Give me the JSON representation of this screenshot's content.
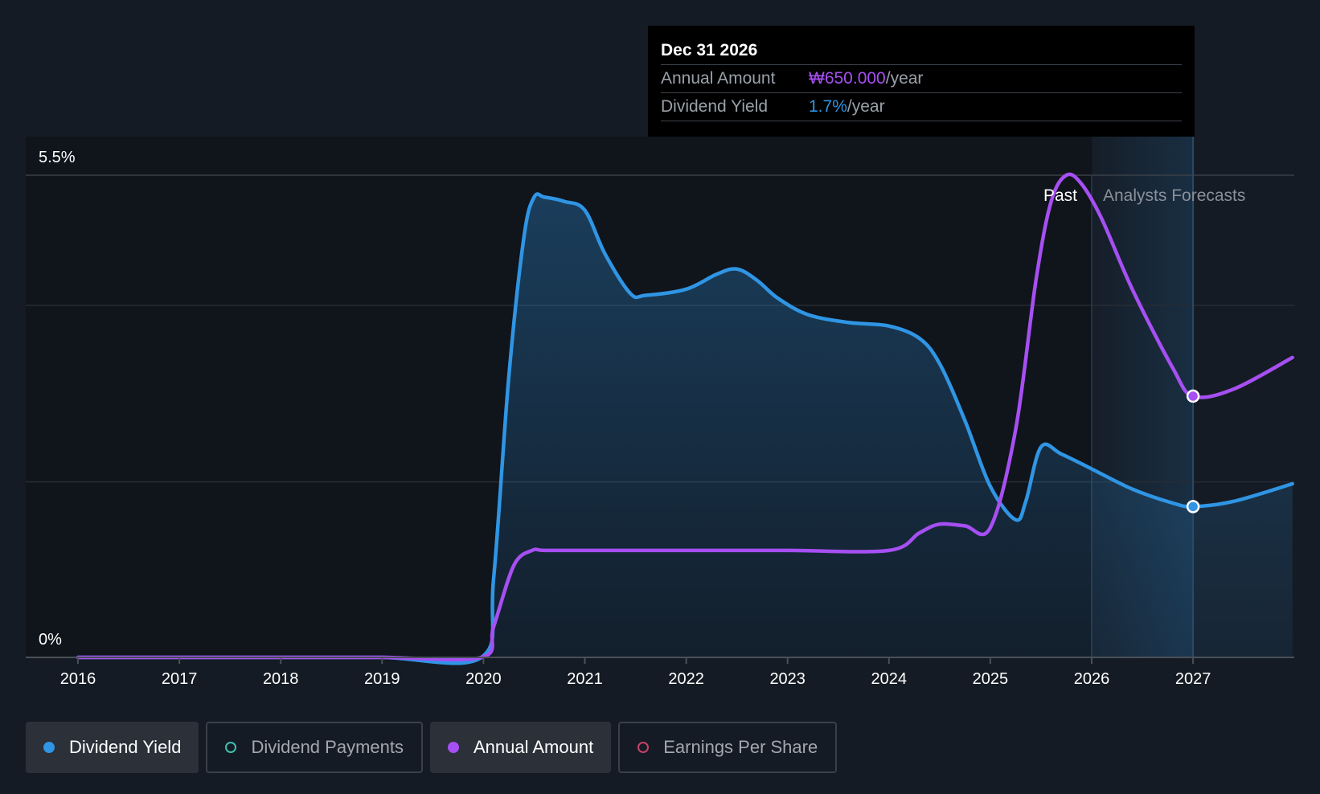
{
  "tooltip": {
    "date": "Dec 31 2026",
    "rows": [
      {
        "label": "Annual Amount",
        "value": "₩650.000",
        "unit": "/year",
        "color": "#a64ff2"
      },
      {
        "label": "Dividend Yield",
        "value": "1.7%",
        "unit": "/year",
        "color": "#2f95e4"
      }
    ]
  },
  "legend": [
    {
      "label": "Dividend Yield",
      "active": true,
      "filled": true,
      "color": "#2f95e4"
    },
    {
      "label": "Dividend Payments",
      "active": false,
      "filled": false,
      "color": "#3fbfb0"
    },
    {
      "label": "Annual Amount",
      "active": true,
      "filled": true,
      "color": "#a64ff2"
    },
    {
      "label": "Earnings Per Share",
      "active": false,
      "filled": false,
      "color": "#c7416b"
    }
  ],
  "chart_data": {
    "type": "line",
    "title": "",
    "xlabel": "",
    "ylabel": "",
    "ylim": [
      0,
      5.5
    ],
    "y_tick_labels": [
      "0%",
      "5.5%"
    ],
    "x_ticks": [
      2016,
      2017,
      2018,
      2019,
      2020,
      2021,
      2022,
      2023,
      2024,
      2025,
      2026,
      2027
    ],
    "xlim": [
      2015.5,
      2027.98
    ],
    "past_label": "Past",
    "forecast_label": "Analysts Forecasts",
    "forecast_start": 2026,
    "hover_x": 2027,
    "colors": {
      "dividend_yield": "#2f95e4",
      "annual_amount": "#a64ff2"
    },
    "series": [
      {
        "name": "Dividend Yield",
        "area": true,
        "x": [
          2016,
          2017,
          2018,
          2019,
          2019.98,
          2020.1,
          2020.25,
          2020.4,
          2020.5,
          2020.6,
          2020.8,
          2021.0,
          2021.2,
          2021.45,
          2021.6,
          2022.0,
          2022.3,
          2022.5,
          2022.7,
          2022.9,
          2023.2,
          2023.6,
          2024.0,
          2024.3,
          2024.5,
          2024.75,
          2025.0,
          2025.25,
          2025.35,
          2025.5,
          2025.7,
          2026.0,
          2026.4,
          2026.8,
          2027.0,
          2027.4,
          2027.98
        ],
        "values": [
          0,
          0,
          0,
          0,
          0,
          0.9,
          3.2,
          4.8,
          5.25,
          5.25,
          5.2,
          5.1,
          4.6,
          4.15,
          4.13,
          4.2,
          4.37,
          4.43,
          4.3,
          4.1,
          3.91,
          3.82,
          3.78,
          3.64,
          3.35,
          2.7,
          1.95,
          1.57,
          1.78,
          2.4,
          2.32,
          2.15,
          1.92,
          1.76,
          1.72,
          1.78,
          1.98
        ]
      },
      {
        "name": "Annual Amount",
        "area": false,
        "x": [
          2016,
          2017,
          2018,
          2019,
          2019.98,
          2020.1,
          2020.3,
          2020.48,
          2020.6,
          2021,
          2022,
          2023,
          2024.0,
          2024.3,
          2024.5,
          2024.75,
          2025.0,
          2025.25,
          2025.45,
          2025.6,
          2025.75,
          2025.9,
          2026.1,
          2026.4,
          2026.8,
          2027.0,
          2027.4,
          2027.98
        ],
        "values": [
          0,
          0,
          0,
          0,
          0,
          0.35,
          1.05,
          1.22,
          1.22,
          1.22,
          1.22,
          1.22,
          1.22,
          1.42,
          1.52,
          1.5,
          1.48,
          2.6,
          4.3,
          5.2,
          5.5,
          5.4,
          5.0,
          4.2,
          3.3,
          2.98,
          3.06,
          3.42
        ]
      }
    ]
  }
}
